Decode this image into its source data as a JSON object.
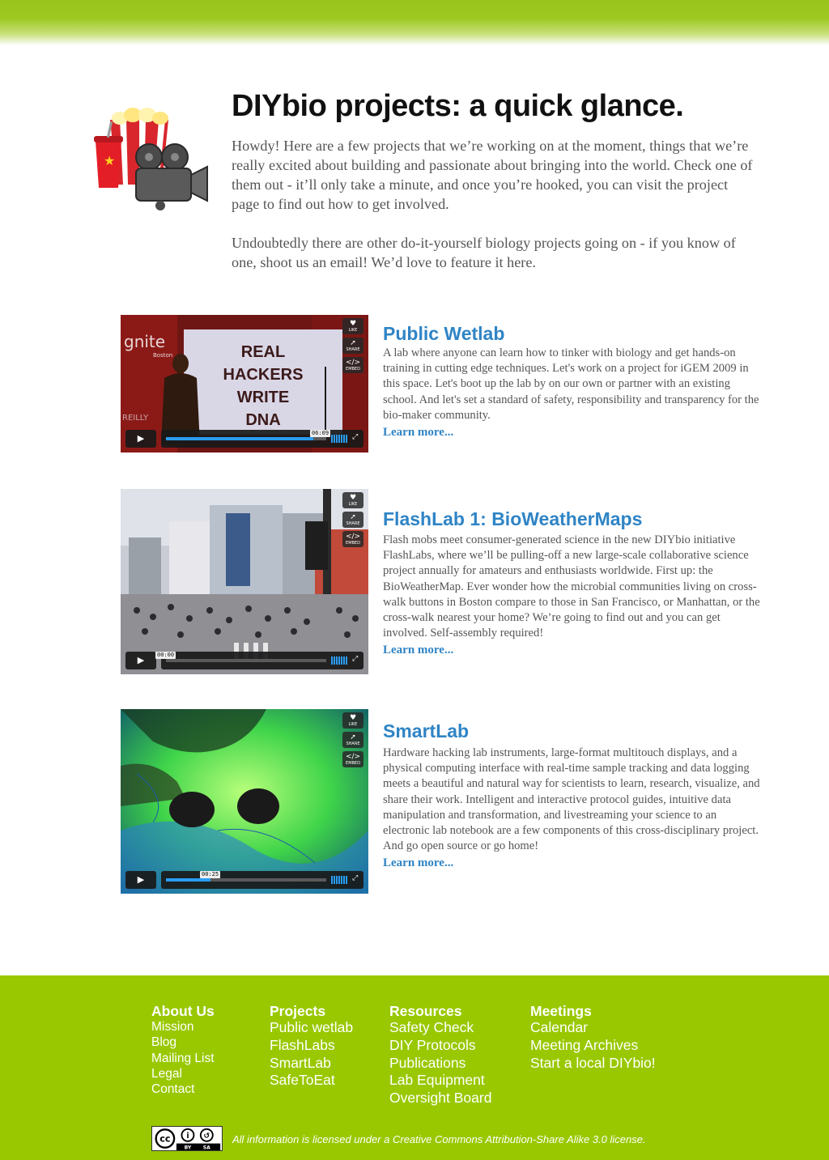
{
  "page": {
    "title": "DIYbio projects: a quick glance.",
    "intro_p1": "Howdy!  Here are a few projects that we’re working on at the moment, things that we’re really excited about building and passionate about bringing into the world.  Check one of them out - it’ll only take a minute, and once you’re hooked, you can visit the project page to find out how to get involved.",
    "intro_p2": "Undoubtedly there are other do-it-yourself biology projects going on - if you know of one, shoot us an email!  We’d love to feature it here.",
    "hero_icon": "popcorn-and-film-camera-icon"
  },
  "video_controls": {
    "like": "LIKE",
    "share": "SHARE",
    "embed": "EMBED"
  },
  "projects": [
    {
      "title": "Public Wetlab",
      "text": "A lab where anyone can learn how to tinker with biology and get hands-on training in cutting edge techniques.  Let's work on a project for iGEM 2009 in this space.  Let's boot up the lab by on our own or partner with an existing school.  And let's set a standard of safety, responsibility and transparency for the bio-maker community.",
      "learn_more": "Learn more...",
      "video": {
        "timecode": "06:09",
        "progress": 0.92,
        "slide_line1": "REAL",
        "slide_line2": "HACKERS",
        "slide_line3": "WRITE",
        "slide_line4": "DNA",
        "banner_text": "gnite",
        "banner_sub": "Boston",
        "brand_text": "REILLY"
      }
    },
    {
      "title": "FlashLab 1: BioWeatherMaps",
      "text": "Flash mobs meet consumer-generated science in the new DIYbio initiative FlashLabs, where we’ll be pulling-off a new large-scale collaborative science project annually for amateurs and enthusiasts worldwide.  First up: the BioWeatherMap.  Ever wonder how the microbial communities living on cross-walk buttons in Boston compare to those in San Francisco, or Manhattan, or the cross-walk nearest your home?  We’re going to find out and you can get involved.  Self-assembly required!",
      "learn_more": "Learn more...",
      "video": {
        "timecode": "00:00",
        "progress": 0.0
      }
    },
    {
      "title": "SmartLab",
      "text": "Hardware hacking lab instruments, large-format multitouch displays, and a physical computing interface with real-time sample tracking and data logging meets a beautiful and natural way for scientists to learn, research, visualize, and share their work.  Intelligent and interactive protocol guides, intuitive data manipulation and transformation, and livestreaming your science to an electronic lab notebook are a few components of this cross-disciplinary project.  And go open source or go home!",
      "learn_more": "Learn more...",
      "video": {
        "timecode": "00:25",
        "progress": 0.28
      }
    }
  ],
  "footer": {
    "columns": [
      {
        "heading": "About Us",
        "links": [
          "Mission",
          "Blog",
          "Mailing List",
          "Legal",
          "Contact"
        ]
      },
      {
        "heading": "Projects",
        "links": [
          "Public wetlab",
          "FlashLabs",
          "SmartLab",
          "SafeToEat"
        ]
      },
      {
        "heading": "Resources",
        "links": [
          "Safety Check",
          "DIY Protocols",
          "Publications",
          "Lab Equipment",
          "Oversight Board"
        ]
      },
      {
        "heading": "Meetings",
        "links": [
          "Calendar",
          "Meeting Archives",
          "Start a local DIYbio!"
        ]
      }
    ],
    "license": "All information is licensed under a Creative Commons Attribution-Share Alike 3.0 license.",
    "cc_badge": {
      "by": "BY",
      "sa": "SA",
      "icon": "creative-commons-by-sa-icon"
    }
  },
  "colors": {
    "brand_green": "#99c800",
    "link_blue": "#2f84c5",
    "body_text": "#555555"
  }
}
